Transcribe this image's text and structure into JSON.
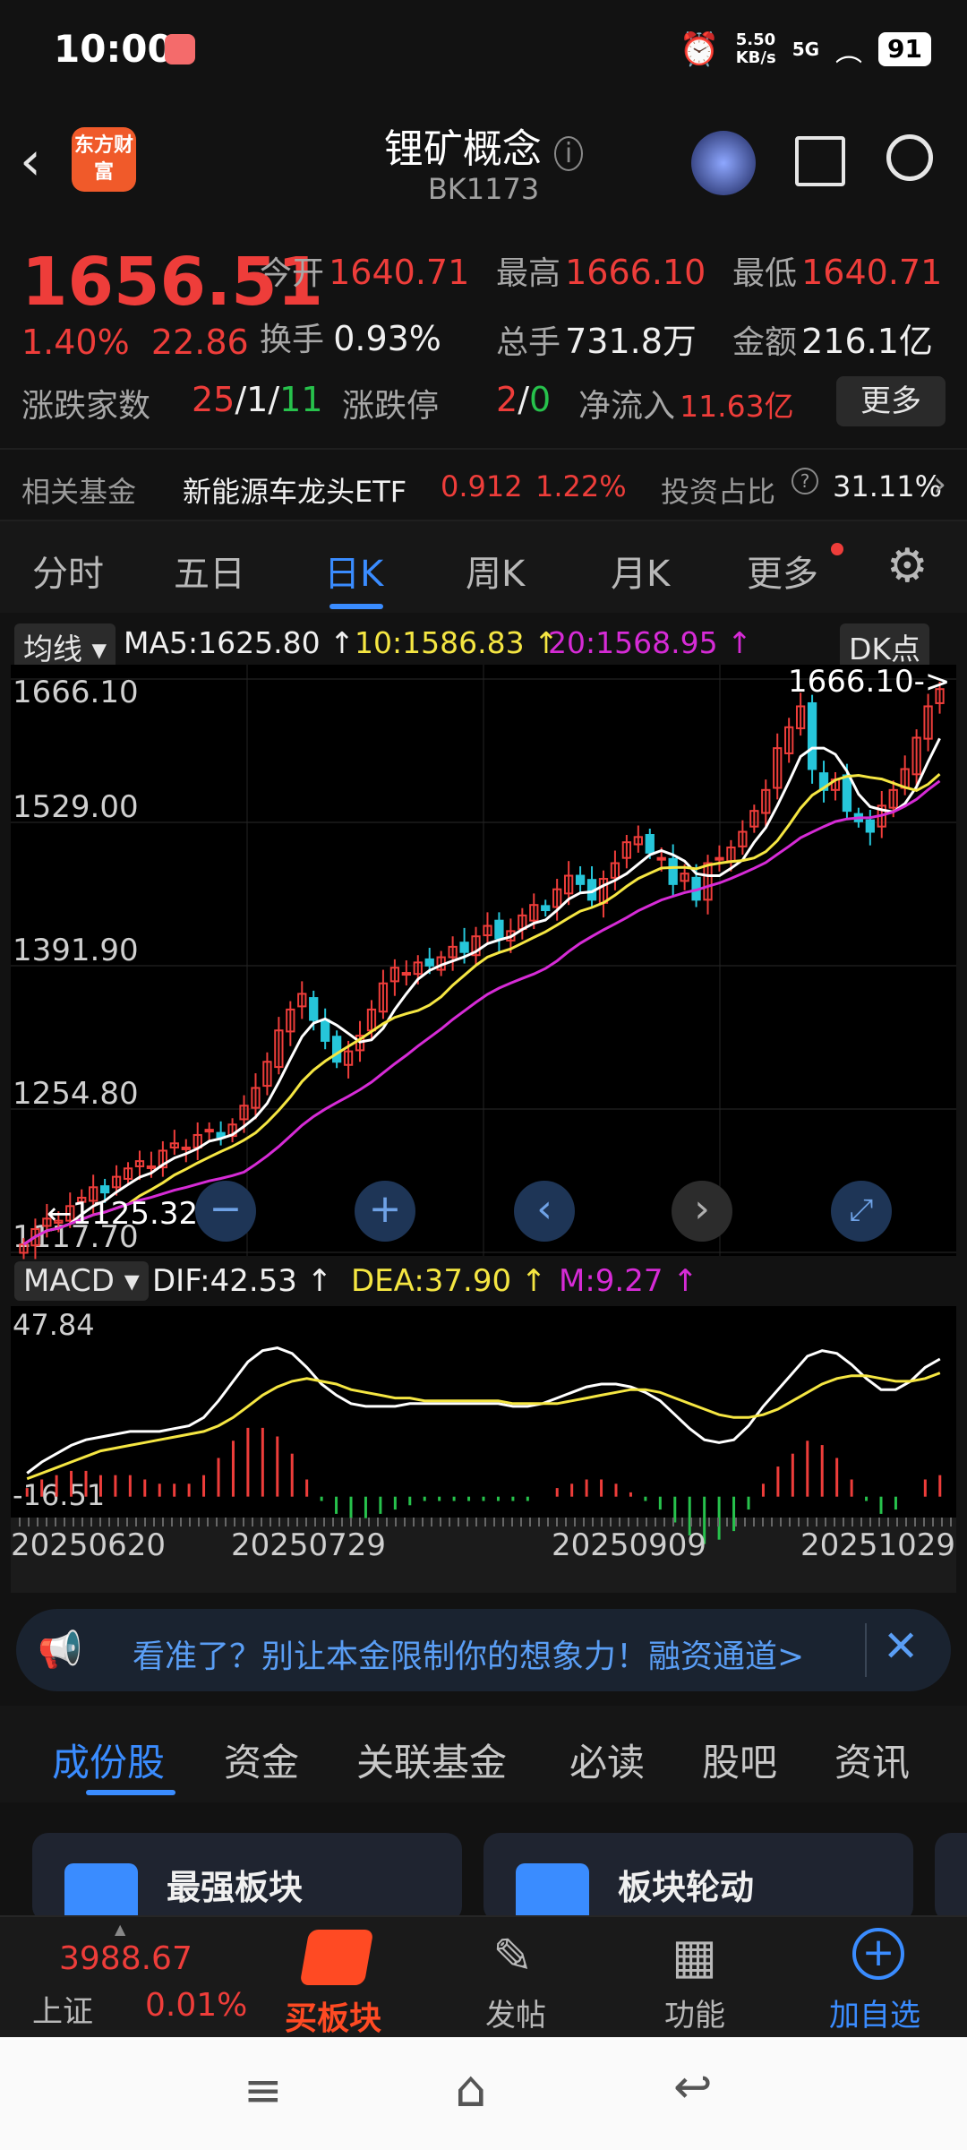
{
  "status": {
    "time": "10:00",
    "net_speed_top": "5.50",
    "net_speed_bottom": "KB/s",
    "signal": "5G",
    "battery": "91"
  },
  "header": {
    "logo_text": "东方财富",
    "title": "锂矿概念",
    "code": "BK1173"
  },
  "quote": {
    "price": "1656.51",
    "change_pct": "1.40%",
    "change_abs": "22.86",
    "open_label": "今开",
    "open": "1640.71",
    "high_label": "最高",
    "high": "1666.10",
    "low_label": "最低",
    "low": "1640.71",
    "turnover_label": "换手",
    "turnover": "0.93%",
    "volume_label": "总手",
    "volume": "731.8万",
    "amount_label": "金额",
    "amount": "216.1亿",
    "updown_label": "涨跌家数",
    "up_count": "25",
    "flat_count": "1",
    "down_count": "11",
    "limit_label": "涨跌停",
    "limit_up": "2",
    "limit_down": "0",
    "netflow_label": "净流入",
    "netflow": "11.63亿",
    "more_button": "更多"
  },
  "fund_row": {
    "label": "相关基金",
    "name": "新能源车龙头ETF",
    "price": "0.912",
    "change": "1.22%",
    "ratio_label": "投资占比",
    "ratio": "31.11%"
  },
  "kline_tabs": [
    "分时",
    "五日",
    "日K",
    "周K",
    "月K",
    "更多"
  ],
  "ma_bar": {
    "mode": "均线",
    "ma5": "MA5:1625.80 ↑",
    "ma10": "10:1586.83 ↑",
    "ma20": "20:1568.95 ↑",
    "dk": "DK点"
  },
  "macd_bar": {
    "mode": "MACD",
    "dif": "DIF:42.53 ↑",
    "dea": "DEA:37.90 ↑",
    "m": "M:9.27 ↑"
  },
  "colors": {
    "up": "#ee3d3a",
    "down": "#26c6da",
    "ma5": "#ffffff",
    "ma10": "#f5e642",
    "ma20": "#d62bd6",
    "accent": "#3a8cff"
  },
  "chart_data": [
    {
      "type": "candlestick",
      "price_ticks": [
        "1666.10",
        "1529.00",
        "1391.90",
        "1254.80",
        "1117.70"
      ],
      "ylim": [
        1117.7,
        1666.1
      ],
      "high_marker": "1666.10",
      "low_marker": "1125.32",
      "x_tick_labels": [
        "20250620",
        "20250729",
        "20250909",
        "20251029"
      ],
      "close_series": [
        1125.32,
        1140,
        1150,
        1148,
        1162,
        1170,
        1180,
        1175,
        1190,
        1198,
        1205,
        1200,
        1215,
        1222,
        1218,
        1230,
        1235,
        1228,
        1240,
        1258,
        1275,
        1300,
        1330,
        1350,
        1365,
        1340,
        1320,
        1300,
        1310,
        1325,
        1350,
        1375,
        1390,
        1385,
        1395,
        1392,
        1400,
        1410,
        1405,
        1420,
        1430,
        1418,
        1425,
        1440,
        1450,
        1445,
        1465,
        1478,
        1470,
        1455,
        1475,
        1490,
        1510,
        1515,
        1500,
        1495,
        1470,
        1480,
        1455,
        1490,
        1495,
        1505,
        1520,
        1540,
        1560,
        1600,
        1620,
        1640,
        1580,
        1560,
        1570,
        1540,
        1530,
        1520,
        1545,
        1560,
        1580,
        1610,
        1640,
        1656.51
      ]
    },
    {
      "type": "macd",
      "ticks": [
        "47.84",
        "-16.51"
      ],
      "ylim": [
        -16.51,
        47.84
      ],
      "dif": [
        2,
        6,
        9,
        12,
        14,
        15,
        16,
        17,
        17,
        17,
        18,
        19,
        22,
        28,
        35,
        42,
        46,
        47,
        45,
        40,
        34,
        30,
        27,
        26,
        26,
        26,
        27,
        27,
        27,
        27,
        27,
        27,
        27,
        26,
        26,
        27,
        29,
        31,
        33,
        34,
        34,
        33,
        31,
        28,
        23,
        18,
        14,
        13,
        14,
        19,
        26,
        32,
        38,
        44,
        46,
        45,
        41,
        36,
        32,
        32,
        35,
        40,
        43
      ],
      "dea": [
        0,
        2,
        4,
        6,
        8,
        10,
        11,
        12,
        13,
        14,
        15,
        16,
        17,
        19,
        22,
        26,
        30,
        33,
        35,
        36,
        35,
        34,
        32,
        31,
        30,
        29,
        29,
        28,
        28,
        28,
        28,
        28,
        28,
        27,
        27,
        27,
        27,
        28,
        29,
        30,
        31,
        32,
        32,
        31,
        29,
        27,
        25,
        23,
        22,
        22,
        23,
        25,
        28,
        31,
        34,
        36,
        37,
        37,
        36,
        35,
        35,
        36,
        38
      ],
      "hist": [
        4,
        8,
        10,
        12,
        12,
        10,
        10,
        10,
        8,
        6,
        6,
        6,
        10,
        18,
        26,
        32,
        32,
        28,
        20,
        8,
        -2,
        -8,
        -10,
        -10,
        -8,
        -6,
        -4,
        -2,
        -2,
        -2,
        -2,
        -2,
        -2,
        -2,
        -2,
        0,
        4,
        6,
        8,
        8,
        6,
        2,
        -2,
        -6,
        -12,
        -18,
        -22,
        -20,
        -16,
        -6,
        6,
        14,
        20,
        26,
        24,
        18,
        8,
        -2,
        -8,
        -6,
        0,
        8,
        10
      ]
    }
  ],
  "banner": {
    "text": "看准了？别让本金限制你的想象力！融资通道>"
  },
  "sub_tabs": [
    "成份股",
    "资金",
    "关联基金",
    "必读",
    "股吧",
    "资讯"
  ],
  "cards": [
    {
      "title": "最强板块"
    },
    {
      "title": "板块轮动"
    }
  ],
  "bottom_nav": {
    "index_value": "3988.67",
    "index_name": "上证",
    "index_change": "0.01%",
    "buy_label": "买板块",
    "post_label": "发帖",
    "func_label": "功能",
    "watch_label": "加自选"
  }
}
